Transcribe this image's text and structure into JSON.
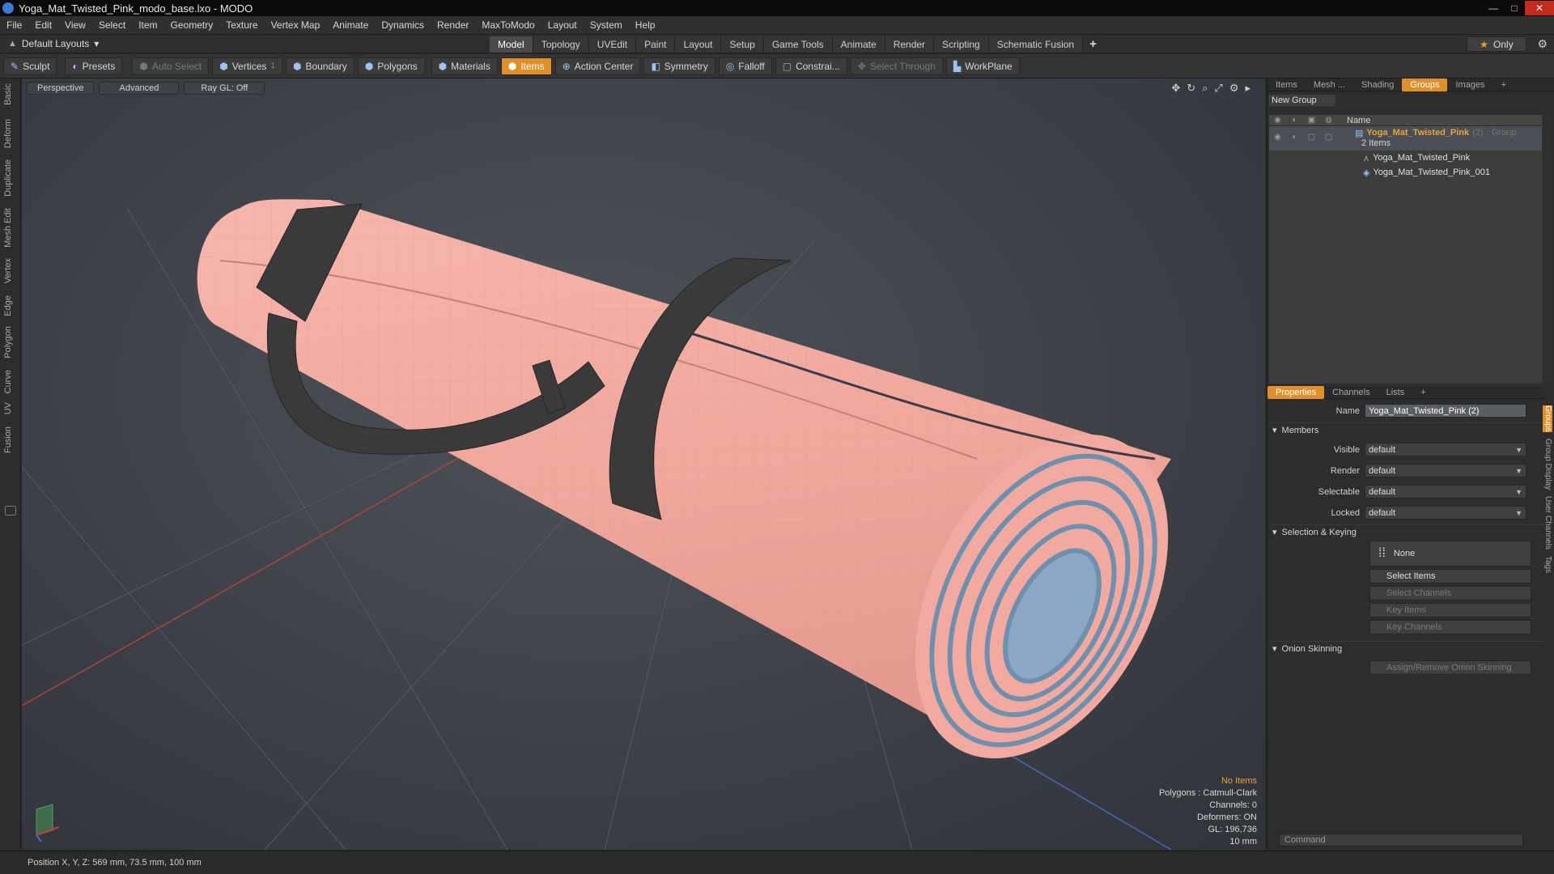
{
  "window": {
    "title": "Yoga_Mat_Twisted_Pink_modo_base.lxo - MODO",
    "min": "—",
    "max": "□",
    "close": "✕"
  },
  "menu": [
    "File",
    "Edit",
    "View",
    "Select",
    "Item",
    "Geometry",
    "Texture",
    "Vertex Map",
    "Animate",
    "Dynamics",
    "Render",
    "MaxToModo",
    "Layout",
    "System",
    "Help"
  ],
  "layout": {
    "dropdown": "Default Layouts",
    "tabs": [
      "Model",
      "Topology",
      "UVEdit",
      "Paint",
      "Layout",
      "Setup",
      "Game Tools",
      "Animate",
      "Render",
      "Scripting",
      "Schematic Fusion"
    ],
    "active_tab": "Model",
    "plus": "+",
    "only": "Only"
  },
  "toolbar": {
    "sculpt": "Sculpt",
    "presets": "Presets",
    "auto_select": "Auto Select",
    "vertices": "Vertices",
    "boundary": "Boundary",
    "polygons": "Polygons",
    "materials": "Materials",
    "items": "Items",
    "action_center": "Action Center",
    "symmetry": "Symmetry",
    "falloff": "Falloff",
    "constraints": "Constrai...",
    "select_through": "Select Through",
    "workplane": "WorkPlane",
    "vertices_count": "1"
  },
  "left_tabs": [
    "Basic",
    "Deform",
    "Duplicate",
    "Mesh Edit",
    "Vertex",
    "Edge",
    "Polygon",
    "Curve",
    "UV",
    "Fusion"
  ],
  "viewport": {
    "view": "Perspective",
    "shading": "Advanced",
    "raygl": "Ray GL: Off",
    "stats": {
      "no_items": "No Items",
      "polygons": "Polygons : Catmull-Clark",
      "channels": "Channels: 0",
      "deformers": "Deformers: ON",
      "gl": "GL: 196,736",
      "scale": "10 mm"
    },
    "colors": {
      "mat_pink": "#f2a9a0",
      "mat_blue": "#6f8fae",
      "strap": "#3a3a3a"
    }
  },
  "groups_panel": {
    "tabs": [
      "Items",
      "Mesh ...",
      "Shading",
      "Groups",
      "Images"
    ],
    "active_tab": "Groups",
    "plus": "+",
    "new_group": "New Group",
    "col_name": "Name",
    "group": {
      "name": "Yoga_Mat_Twisted_Pink",
      "count": "(2)",
      "type": ": Group",
      "sub": "2 Items"
    },
    "children": [
      "Yoga_Mat_Twisted_Pink",
      "Yoga_Mat_Twisted_Pink_001"
    ]
  },
  "properties": {
    "tabs": [
      "Properties",
      "Channels",
      "Lists"
    ],
    "active_tab": "Properties",
    "plus": "+",
    "name_label": "Name",
    "name_value": "Yoga_Mat_Twisted_Pink (2)",
    "members": "Members",
    "rows": [
      {
        "label": "Visible",
        "value": "default"
      },
      {
        "label": "Render",
        "value": "default"
      },
      {
        "label": "Selectable",
        "value": "default"
      },
      {
        "label": "Locked",
        "value": "default"
      }
    ],
    "selection_keying": "Selection & Keying",
    "none": "None",
    "select_items": "Select Items",
    "select_channels": "Select Channels",
    "key_items": "Key Items",
    "key_channels": "Key Channels",
    "onion": "Onion Skinning",
    "onion_btn": "Assign/Remove Onion Skinning",
    "side_tabs": [
      "Groups",
      "Group Display",
      "User Channels",
      "Tags"
    ]
  },
  "command_placeholder": "Command",
  "status": {
    "position": "Position X, Y, Z:  569 mm, 73.5 mm, 100 mm"
  }
}
